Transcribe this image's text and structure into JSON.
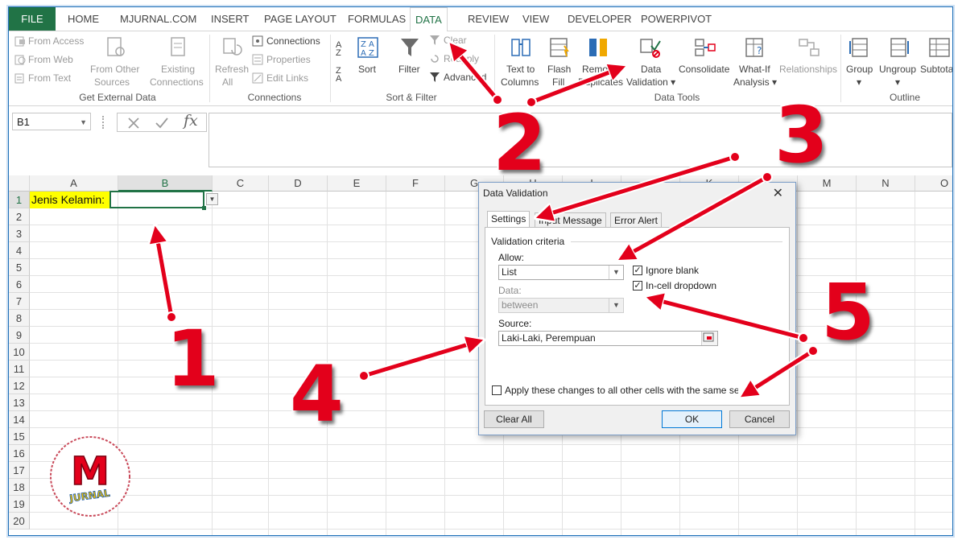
{
  "ribbon_tabs": {
    "file": "FILE",
    "items": [
      {
        "label": "HOME"
      },
      {
        "label": "MJURNAL.COM"
      },
      {
        "label": "INSERT"
      },
      {
        "label": "PAGE LAYOUT"
      },
      {
        "label": "FORMULAS"
      },
      {
        "label": "DATA"
      },
      {
        "label": "REVIEW"
      },
      {
        "label": "VIEW"
      },
      {
        "label": "DEVELOPER"
      },
      {
        "label": "POWERPIVOT"
      }
    ],
    "active": "DATA"
  },
  "ribbon": {
    "get_external": {
      "from_access": "From Access",
      "from_web": "From Web",
      "from_text": "From Text",
      "from_other_1": "From Other",
      "from_other_2": "Sources",
      "existing_1": "Existing",
      "existing_2": "Connections",
      "group_label": "Get External Data"
    },
    "connections": {
      "refresh_1": "Refresh",
      "refresh_2": "All",
      "connections": "Connections",
      "properties": "Properties",
      "edit_links": "Edit Links",
      "group_label": "Connections"
    },
    "sort_filter": {
      "sort": "Sort",
      "filter": "Filter",
      "clear": "Clear",
      "reapply": "Reapply",
      "advanced": "Advanced",
      "group_label": "Sort & Filter"
    },
    "data_tools": {
      "text_to_1": "Text to",
      "text_to_2": "Columns",
      "flash_1": "Flash",
      "flash_2": "Fill",
      "remove_1": "Remove",
      "remove_2": "Duplicates",
      "dv_1": "Data",
      "dv_2": "Validation",
      "consolidate": "Consolidate",
      "whatif_1": "What-If",
      "whatif_2": "Analysis",
      "relationships": "Relationships",
      "group_label": "Data Tools"
    },
    "outline": {
      "group": "Group",
      "ungroup": "Ungroup",
      "subtotal": "Subtotal",
      "group_label": "Outline"
    }
  },
  "formula_bar": {
    "name_box": "B1",
    "formula": ""
  },
  "sheet": {
    "columns": [
      "A",
      "B",
      "C",
      "D",
      "E",
      "F",
      "G",
      "H",
      "I",
      "J",
      "K",
      "L",
      "M",
      "N",
      "O"
    ],
    "rows": [
      "1",
      "2",
      "3",
      "4",
      "5",
      "6",
      "7",
      "8",
      "9",
      "10",
      "11",
      "12",
      "13",
      "14",
      "15",
      "16",
      "17",
      "18",
      "19",
      "20"
    ],
    "selected_column": "B",
    "selected_row": "1",
    "a1": "Jenis Kelamin:"
  },
  "dialog": {
    "title": "Data Validation",
    "tabs": [
      "Settings",
      "Input Message",
      "Error Alert"
    ],
    "active_tab": "Settings",
    "section": "Validation criteria",
    "allow_label": "Allow:",
    "allow_value": "List",
    "ignore_blank": "Ignore blank",
    "incell_dropdown": "In-cell dropdown",
    "data_label": "Data:",
    "data_value": "between",
    "source_label": "Source:",
    "source_value": "Laki-Laki, Perempuan",
    "apply_text": "Apply these changes to all other cells with the same settings",
    "clear_all": "Clear All",
    "ok": "OK",
    "cancel": "Cancel",
    "checks": {
      "ignore_blank": true,
      "incell_dropdown": true,
      "apply_all": false
    }
  },
  "annotations": {
    "n1": "1",
    "n2": "2",
    "n3": "3",
    "n4": "4",
    "n5": "5"
  },
  "logo": {
    "letter": "M",
    "word": "JURNAL"
  },
  "colors": {
    "excel_green": "#217346",
    "arrow_red": "#e3001b",
    "highlight_yellow": "#ffff00"
  }
}
